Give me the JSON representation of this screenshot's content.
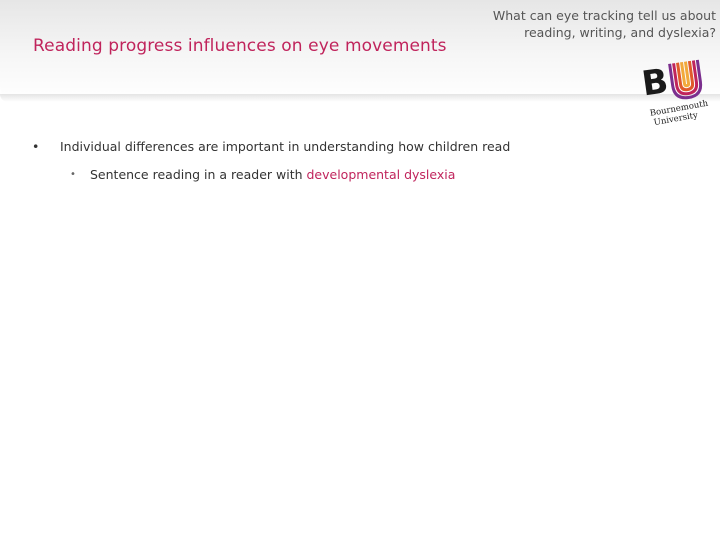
{
  "header": {
    "slide_title": "Reading progress influences on eye movements",
    "deck_title_line1": "What can eye tracking tell us about",
    "deck_title_line2": "reading, writing, and dyslexia?"
  },
  "logo": {
    "letters": "BU",
    "name_line1": "Bournemouth",
    "name_line2": "University",
    "colors": {
      "b": "#1a1a1a",
      "u_stripes": [
        "#7b2f8e",
        "#c0245c",
        "#e05a2b",
        "#f2a93b"
      ]
    }
  },
  "bullets": [
    {
      "marker": "•",
      "text": "Individual differences are important in understanding how children read",
      "children": [
        {
          "marker": "•",
          "text_plain": "Sentence reading in a reader with ",
          "text_highlight": "developmental dyslexia"
        }
      ]
    }
  ],
  "colors": {
    "accent": "#c0245c",
    "body_text": "#333333",
    "header_band": "#ececec"
  }
}
